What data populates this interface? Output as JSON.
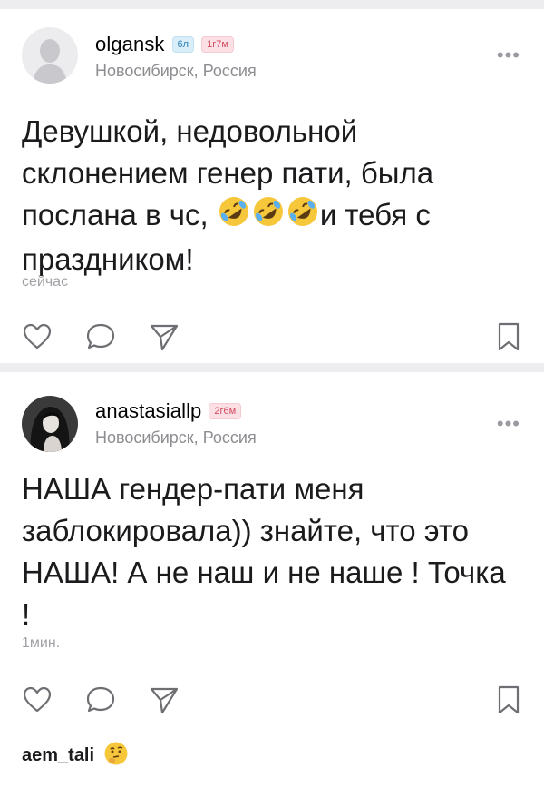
{
  "posts": [
    {
      "username": "olgansk",
      "badge_age": "6л",
      "badge_duration": "1г7м",
      "location": "Новосибирск, Россия",
      "text_before_emoji": "Девушкой, недовольной склонением генер пати, была послана в чс,",
      "emoji": [
        "rolling-on-floor-laughing",
        "rolling-on-floor-laughing",
        "rolling-on-floor-laughing"
      ],
      "text_after_emoji": "и тебя с праздником!",
      "time": "сейчас",
      "avatar": "default-avatar-placeholder"
    },
    {
      "username": "anastasiallp",
      "badge_duration": "2г6м",
      "location": "Новосибирск, Россия",
      "text": "НАША гендер-пати меня заблокировала)) знайте, что это НАША! А не наш и не наше ! Точка !",
      "time": "1мин.",
      "avatar": "user-photo",
      "comment_preview": {
        "username": "aem_tali",
        "emoji": "thinking-face"
      }
    }
  ],
  "icons": {
    "more": "more-dots-icon",
    "like": "heart-icon",
    "comment": "comment-bubble-icon",
    "share": "share-plane-icon",
    "bookmark": "bookmark-icon"
  },
  "colors": {
    "badge_age_bg": "#d9eef8",
    "badge_duration_bg": "#fbe1e5",
    "secondary_text": "#8d8d92",
    "action_icon": "#6e6e73"
  }
}
